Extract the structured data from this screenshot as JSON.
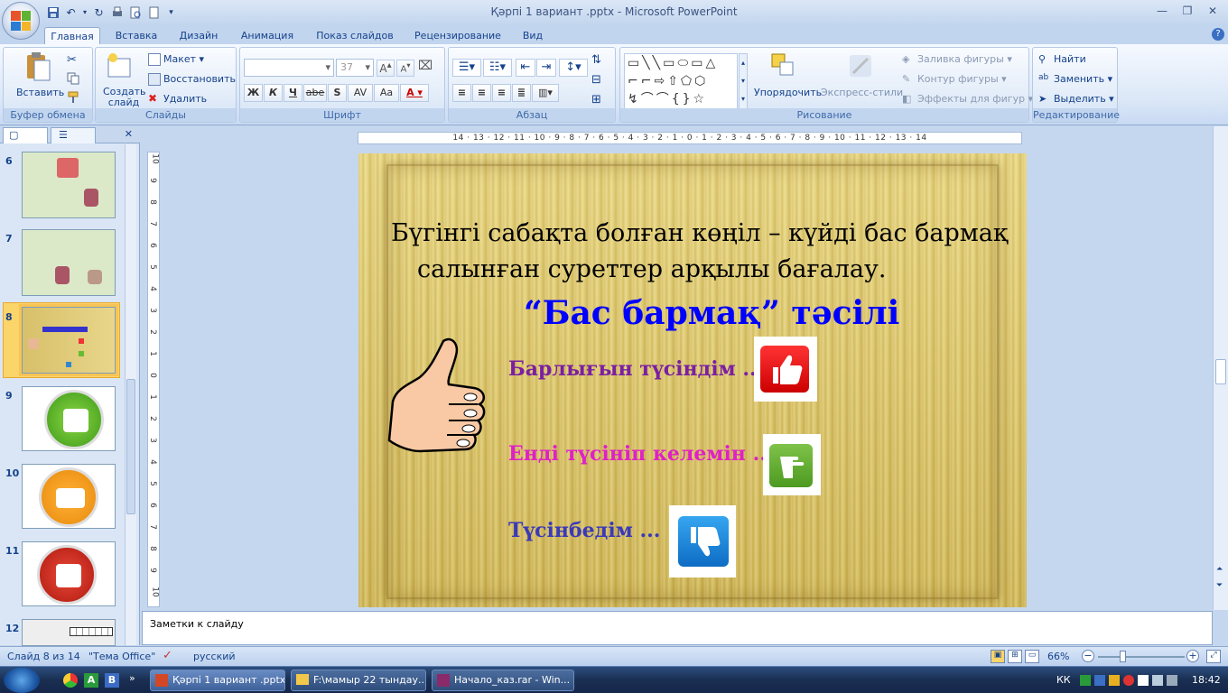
{
  "window": {
    "title": "Қәрпі 1 вариант .pptx - Microsoft PowerPoint"
  },
  "tabs": [
    "Главная",
    "Вставка",
    "Дизайн",
    "Анимация",
    "Показ слайдов",
    "Рецензирование",
    "Вид"
  ],
  "active_tab": "Главная",
  "ribbon": {
    "clipboard": {
      "paste": "Вставить",
      "label": "Буфер обмена"
    },
    "slides": {
      "new_slide": "Создать слайд",
      "layout": "Макет",
      "reset": "Восстановить",
      "delete": "Удалить",
      "label": "Слайды"
    },
    "font": {
      "size": "37",
      "label": "Шрифт",
      "bold": "Ж",
      "italic": "К",
      "underline": "Ч",
      "strike": "abe",
      "shadow": "S",
      "spacing": "AV",
      "case": "Aa"
    },
    "paragraph": {
      "label": "Абзац"
    },
    "drawing": {
      "arrange": "Упорядочить",
      "quick_styles": "Экспресс-стили",
      "fill": "Заливка фигуры",
      "outline": "Контур фигуры",
      "effects": "Эффекты для фигур",
      "label": "Рисование"
    },
    "editing": {
      "find": "Найти",
      "replace": "Заменить",
      "select": "Выделить",
      "label": "Редактирование"
    }
  },
  "ruler": {
    "horizontal": "14 · 13 · 12 · 11 · 10 · 9 · 8 · 7 · 6 · 5 · 4 · 3 · 2 · 1 · 0 · 1 · 2 · 3 · 4 · 5 · 6 · 7 · 8 · 9 · 10 · 11 · 12 · 13 · 14",
    "vertical": [
      "10",
      "9",
      "8",
      "7",
      "6",
      "5",
      "4",
      "3",
      "2",
      "1",
      "0",
      "1",
      "2",
      "3",
      "4",
      "5",
      "6",
      "7",
      "8",
      "9",
      "10"
    ]
  },
  "thumbnails": [
    "6",
    "7",
    "8",
    "9",
    "10",
    "11",
    "12"
  ],
  "selected_slide": "8",
  "slide": {
    "line1": "Бүгінгі сабақта болған көңіл – күйді  бас бармақ",
    "line2": "салынған суреттер  арқылы бағалау.",
    "heading": "“Бас бармақ” тәсілі",
    "item1": "Барлығын түсіндім ...",
    "item2": "Енді түсініп келемін ...",
    "item3": "Түсінбедім ...",
    "colors": {
      "heading": "#0000ff",
      "item1": "#7b1fa2",
      "item2": "#e020c8",
      "item3": "#3a3ab8"
    }
  },
  "notes_placeholder": "Заметки к слайду",
  "status": {
    "slide": "Слайд 8 из 14",
    "theme": "\"Тема Office\"",
    "language": "русский",
    "zoom": "66%"
  },
  "taskbar": {
    "items": [
      "Қәрпі 1 вариант .pptx",
      "F:\\мамыр 22 тындау...",
      "Начало_каз.rar - Win..."
    ],
    "lang": "КК",
    "time": "18:42"
  }
}
